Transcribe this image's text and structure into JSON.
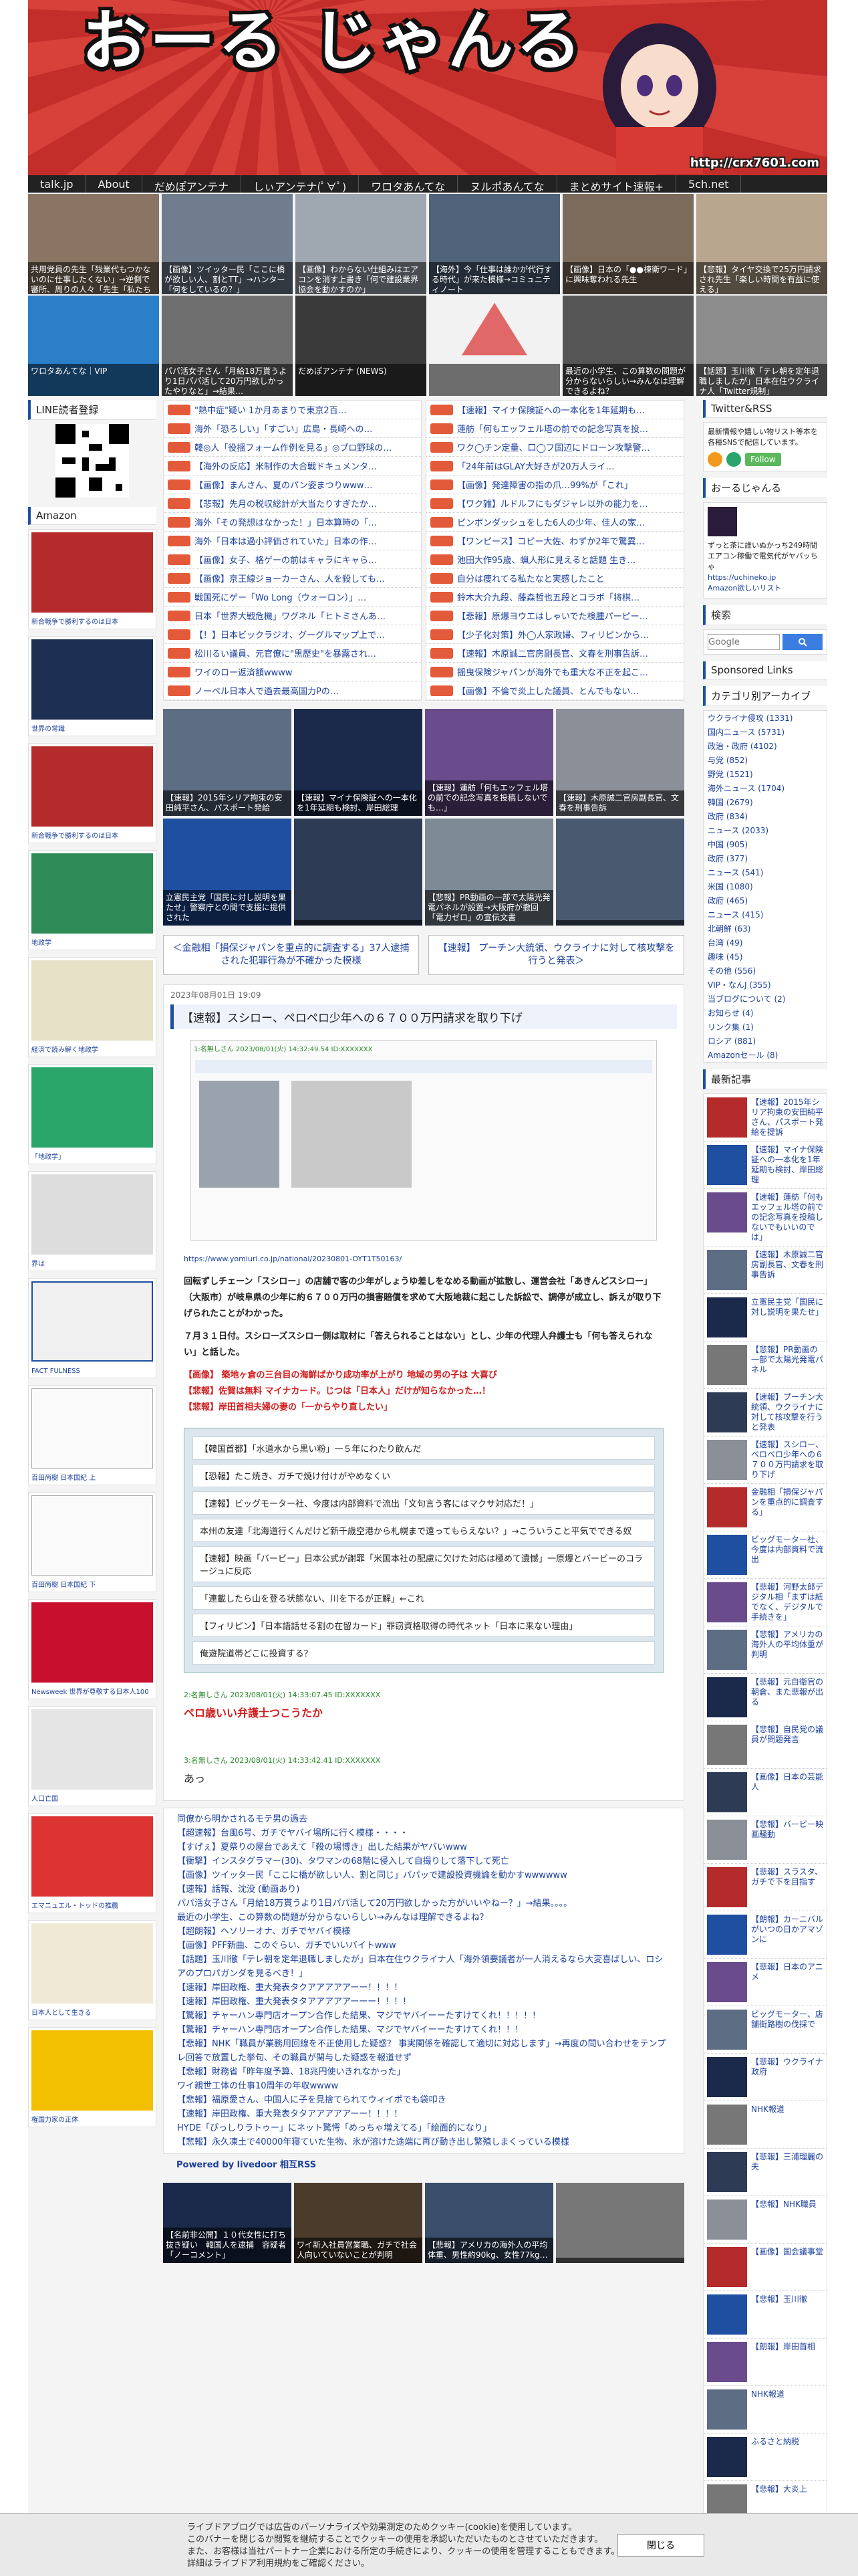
{
  "header": {
    "title": "おーる じゃんる",
    "url": "http://crx7601.com"
  },
  "nav": [
    "talk.jp",
    "About",
    "だめぽアンテナ",
    "しぃアンテナ(ﾟ∀ﾟ)",
    "ワロタあんてな",
    "ヌルポあんてな",
    "まとめサイト速報+",
    "5ch.net"
  ],
  "ticker_top": [
    "共用党員の先生「残業代もつかないのに仕事したくない」→逆側で審所、周りの人々「先生「私たちも辞りまし」→3年",
    "【画像】ツイッター民「ここに橋が欲しい人、割とTT」→ハンター「何をしているの？」",
    "【画像】わからない仕組みはエアコンを消す上書き「何で建設業界協会を動かすのか」",
    "【海外】今「仕事は誰かが代行する時代」が来た模様→コミュニティノート",
    "【画像】日本の「●●棟衛ワード」に興味奪われる先生",
    "【悲報】タイヤ交換で25万円請求され先生「楽しい時間を有益に使える」"
  ],
  "ticker_bottom": [
    "ワロタあんてな｜VIP",
    "パパ活女子さん「月給18万貰うより1日パパ活して20万円欲しかったやりなと」→結果…",
    "だめぽアンテナ (NEWS)",
    "",
    "最近の小学生、この算数の問題が分からないらしい→みんなは理解できるよね？",
    "【話題】玉川徹「テレ朝を定年退職しましたが」日本在住ウクライナ人「Twitter規制」"
  ],
  "left": {
    "line_header": "LINE読者登録",
    "amazon_header": "Amazon",
    "books": [
      "新合戦争で勝利するのは日本",
      "世界の常識",
      "新合戦争で勝利するのは日本",
      "地政学",
      "経済で読み解く地政学",
      "「地政学」",
      "界は",
      "FACT FULNESS",
      "百田尚樹 日本国紀 上",
      "百田尚樹 日本国紀 下",
      "Newsweek 世界が尊敬する日本人100",
      "人口亡国",
      "エマニュエル・トッドの推薦",
      "日本人として生きる",
      "権国力家の正体"
    ]
  },
  "center": {
    "news_left": [
      "\"熱中症\"疑い 1か月あまりで東京2百…",
      "海外「恐ろしい」「すごい」広島・長崎への…",
      "韓◎人「役揺フォーム作例を見る」◎プロ野球の…",
      "【海外の反応】米制作の大合戦ドキュメンタ…",
      "【画像】まんさん、夏のパン姿まつりwww…",
      "【悲報】先月の税収総計が大当たりすぎたか…",
      "海外「その発想はなかった！」日本算時の「…",
      "海外「日本は過小評価されていた」日本の作…",
      "【画像】女子、格ゲーの前はキャラにキャら…",
      "【画像】京王線ジョーカーさん、人を殺しても…",
      "戦国死にゲー「Wo Long（ウォーロン）」…",
      "日本「世界大戦危機」ワグネル「ヒトミさんあ…",
      "【！】日本ビックラジオ、グーグルマップ上で…",
      "松川るい議員、元官僚に\"黒歴史\"を暴露され…",
      "ワイのロー返済額wwww",
      "ノーベル日本人で過去最高国力Pの…"
    ],
    "news_right": [
      "【速報】マイナ保険証への一本化を1年延期も…",
      "蓮舫「何もエッフェル塔の前での記念写真を投…",
      "ワク◯チン定量、口◯フ国辺にドローン攻撃警…",
      "「24年前はGLAY大好きが20万人ライ…",
      "【画像】発達障害の指の爪…99%が「これ」",
      "【ワク雑】ルドルフにもダジャレ以外の能力を…",
      "ピンボンダッシュをした6人の少年、佳人の家…",
      "【ワンピース】コピー大佐、わずか2年で驚異…",
      "池田大作95歳、蝋人形に見えると話題 生き…",
      "自分は痩れてる私たなと実感したこと",
      "鈴木大介九段、藤森哲也五段とコラボ「将棋…",
      "【悲報】原爆ヨウエはしゃいでた検腫パーピー…",
      "【少子化対策】外◯人家政婦、フィリピンから…",
      "【速報】木原誠二官房副長官、文春を刑事告訴…",
      "揺曳保険ジャパンが海外でも重大な不正を起こ…",
      "【画像】不倫で炎上した議員、とんでもない…"
    ],
    "grid_cards": [
      "【速報】2015年シリア拘束の安田純平さん、パスポート発給",
      "【速報】マイナ保険証への一本化を1年延期も検討、岸田総理",
      "【速報】蓮舫「何もエッフェル塔の前での記念写真を投稿しないでも…」",
      "【速報】木原誠二官房副長官、文春を刑事告訴",
      "立憲民主党「国民に対し説明を果たせ」警察庁との間で支援に提供された",
      "",
      "【悲報】PR動画の一部で太陽光発電パネルが設置→大阪府が撤回「電力ゼロ」の宣伝文書",
      ""
    ],
    "prev_link": "＜金融相「損保ジャパンを重点的に調査する」37人逮捕された犯罪行為が不確かった模様",
    "next_link": "【速報】 プーチン大統領、ウクライナに対して核攻撃を行うと発表＞",
    "article": {
      "date": "2023年08月01日 19:09",
      "title": "【速報】スシロー、ペロペロ少年への６７００万円請求を取り下げ",
      "shot_header": "1:名無しさん 2023/08/01(火) 14:32:49.54 ID:XXXXXXX",
      "source_url": "https://www.yomiuri.co.jp/national/20230801-OYT1T50163/",
      "body1": "回転ずしチェーン「スシロー」の店舗で客の少年がしょうゆ差しをなめる動画が拡散し、運営会社「あきんどスシロー」（大阪市）が岐阜県の少年に約６７００万円の損害賠償を求めて大阪地裁に起こした訴訟で、調停が成立し、訴えが取り下げられたことがわかった。",
      "body2": "７月３１日付。スシローズスシロー側は取材に「答えられることはない」とし、少年の代理人弁護士も「何も答えられない」と話した。",
      "red_links": [
        "【画像】 築地ヶ倉の三台目の海鮮ばかり成功率が上がり 地域の男の子は 大喜び",
        "【悲報】佐賀は無料 マイナカード。じつは「日本人」だけが知らなかった…！",
        "【悲報】岸田首相夫婦の妻の「一からやり直したい」"
      ],
      "boxed_links": [
        "【韓国首都】「水道水から黒い粉」一５年にわたり飲んだ",
        "【恐報】たこ焼き、ガチで焼け付けがやめなくい",
        "【速報】ビッグモーター社、今度は内部資料で流出「文句言う客にはマクサ対応だ！」",
        "本州の友達「北海道行くんだけど新千歳空港から札幌まで遠ってもらえない？」→こういうこと平気でできる奴",
        "【速報】映画「バービー」日本公式が謝罪「米国本社の配慮に欠けた対応は極めて遺憾」一原爆とバービーのコラージュに反応",
        "「連載したら山を登る状態ない、川を下るが正解」←これ",
        "【フィリピン】「日本語話せる割の在留カード」罪窃資格取得の時代ネット「日本に来ない理由」",
        "俺遊院道帯どこに投資する？"
      ],
      "comment2_meta": "2:名無しさん 2023/08/01(火) 14:33:07.45 ID:XXXXXXX",
      "comment2": "ペロ歳いい弁護士つこうたか",
      "comment3_meta": "3:名無しさん 2023/08/01(火) 14:33:42.41 ID:XXXXXXX",
      "comment3": "あっ"
    },
    "related": [
      "同僚から明かされるモテ男の過去",
      "【超速報】台風6号、ガチでヤバイ場所に行く模様・・・・",
      "【すげぇ】夏祭りの屋台であえて「殺の場博き」出した結果がヤバいwww",
      "【衝撃】インスタグラマー(30)、タワマンの68階に侵入して自撮りして落下して死亡",
      "【画像】ツイッター民「ここに橋が欲しい人、割と同じ」パパッで建設投資機論を動かすwwwwww",
      "【速報】話報、沈没 (動画あり)",
      "パパ活女子さん「月給18万貰うより1日パパ活して20万円欲しかった方がいいやねー？」→結果。。。。",
      "最近の小学生、この算数の問題が分からないらしい→みんなは理解できるよね？",
      "【超朗報】ヘソリーオナ、ガチでヤバイ模様",
      "【画像】PFF新曲、このぐらい、ガチでいいバイトwww",
      "【話題】玉川徹「テレ朝を定年退職しましたが」日本在住ウクライナ人「海外領要議者が一人消えるなら大変喜ばしい、ロシアのプロパガンダを見るべき！」",
      "【速報】岸田政権、重大発表タクアアアアアーー！！！！",
      "【速報】岸田政権、重大発表タタアアアアアーーー！！！！",
      "【驚報】チャーハン専門店オープン合作した結果、マジでヤバイーーたすけてくれ！！！！！",
      "【驚報】チャーハン専門店オープン合作した結果、マジでヤバイーーたすけてくれ！！！",
      "【悲報】NHK「職員が業務用回線を不正使用した疑惑？ 事実関係を確認して適切に対応します」→再度の問い合わせをテンプレ回答で放置した挙句、その職員が関与した疑惑を報道せず",
      "【悲報】財務省「昨年度予算、18兆円使いきれなかった」",
      "ワイ親世工体の仕事10周年の年収wwww",
      "【悲報】福原愛さん、中国人に子を見捨てられてウィイポでも袋叩き",
      "【速報】岸田政権、重大発表タタアアアアアーー！！！！",
      "HYDE「ぴっしりラトゥー」にネット驚愕「めっちゃ増えてる」「絵面的になり」",
      "【悲報】永久凍土で40000年寝ていた生物、氷が溶けた途端に再び動き出し繁殖しまくっている模様"
    ],
    "powered": "Powered by livedoor 相互RSS",
    "bottom_cards": [
      "【名前非公開】１０代女性に打ち抜き疑い　韓国人を逮捕　容疑者「ノーコメント」",
      "ワイ新入社員営業職、ガチで社会人向いていないことが判明",
      "【悲報】アメリカの海外人の平均体重、男性約90kg、女性77kg…",
      ""
    ]
  },
  "right": {
    "twitter_header": "Twitter&RSS",
    "twitter_text": "最新情報や嬉しい物リスト等本を各種SNSで配信しています。",
    "follow": "Follow",
    "profile_header": "おーるじゃんる",
    "profile_text": "ずっと茶に誰いぬかっち249時間エアコン稼働で電気代がヤバッちゃ",
    "profile_links": [
      "https://uchineko.jp",
      "Amazon欲しいリスト"
    ],
    "search_header": "検索",
    "search_placeholder": "Google",
    "sponsored_header": "Sponsored Links",
    "category_header": "カテゴリ別アーカイブ",
    "categories": [
      "ウクライナ侵攻 (1331)",
      "国内ニュース (5731)",
      "政治・政府 (4102)",
      "与党 (852)",
      "野党 (1521)",
      "海外ニュース (1704)",
      "韓国 (2679)",
      "政府 (834)",
      "ニュース (2033)",
      "中国 (905)",
      "政府 (377)",
      "ニュース (541)",
      "米国 (1080)",
      "政府 (465)",
      "ニュース (415)",
      "北朝鮮 (63)",
      "台湾 (49)",
      "趣味 (45)",
      "その他 (556)",
      "VIP・なんJ (355)",
      "当ブログについて (2)",
      "お知らせ (4)",
      "リンク集 (1)",
      "ロシア (881)",
      "Amazonセール (8)"
    ],
    "recent_header": "最新記事",
    "recent": [
      "【速報】2015年シリア拘束の安田純平さん、パスポート発給を提訴",
      "【速報】マイナ保険証への一本化を1年延期も検討、岸田総理",
      "【速報】蓮舫「何もエッフェル塔の前での記念写真を投稿しないでもいいのでは」",
      "【速報】木原誠二官房副長官、文春を刑事告訴",
      "立憲民主党「国民に対し説明を果たせ」",
      "【悲報】PR動画の一部で太陽光発電パネル",
      "【速報】プーチン大統領、ウクライナに対して核攻撃を行うと発表",
      "【速報】スシロー、ペロペロ少年への６７００万円請求を取り下げ",
      "金融相「損保ジャパンを重点的に調査する」",
      "ビッグモーター社、今度は内部資料で流出",
      "【悲報】河野太郎デジタル相「まずは紙でなく、デジタルで手続きを」",
      "【悲報】アメリカの海外人の平均体重が判明",
      "【悲報】元自衛官の朝倉、また悲報が出る",
      "【悲報】自民党の議員が問題発言",
      "【画像】日本の芸能人",
      "【悲報】バービー映画騒動",
      "【悲報】スラスタ、ガチで下を目指す",
      "【朗報】カーニバルがいつの日かアマゾンに",
      "【悲報】日本のアニメ",
      "ビッグモーター、店舗街路樹の伐採で",
      "【悲報】ウクライナ政府",
      "NHK報道",
      "【悲報】三浦瑠麗の夫",
      "【悲報】NHK職員",
      "【画像】国会議事堂",
      "【悲報】玉川徹",
      "【朗報】岸田首相",
      "NHK報道",
      "ふるさと納税",
      "【悲報】大炎上"
    ]
  },
  "cookie": {
    "text1": "ライブドアブログでは広告のパーソナライズや効果測定のためクッキー(cookie)を使用しています。",
    "text2": "このバナーを閉じるか閲覧を継続することでクッキーの使用を承認いただいたものとさせていただきます。",
    "text3": "また、お客様は当社パートナー企業における所定の手続きにより、クッキーの使用を管理することもできます。",
    "text4": "詳細はライブドア利用規約をご確認ください。",
    "button": "閉じる"
  },
  "colors": {
    "header_red": "#c9322d",
    "accent_blue": "#1e4fa0",
    "link_blue": "#1b3f9c",
    "link_red": "#d21c1c"
  }
}
